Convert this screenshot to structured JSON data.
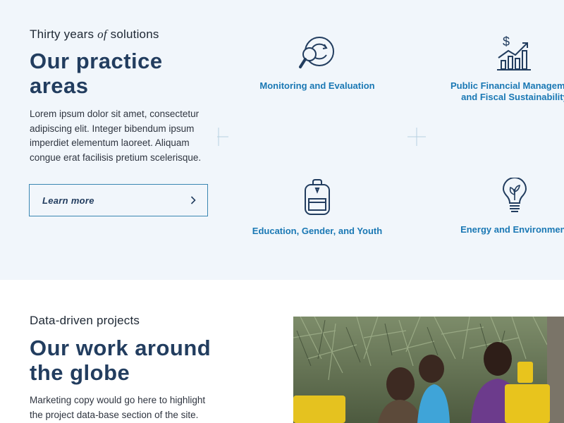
{
  "practice": {
    "eyebrow_pre": "Thirty years ",
    "eyebrow_em": "of",
    "eyebrow_post": " solutions",
    "title_line1": "Our practice",
    "title_line2": "areas",
    "body": "Lorem ipsum dolor sit amet, consectetur adipiscing elit. Integer bibendum ipsum imperdiet elementum laoreet. Aliquam congue erat facilisis pretium scelerisque.",
    "cta_label": "Learn more",
    "areas": [
      {
        "label": "Monitoring and Evaluation",
        "icon": "magnifier-refresh-icon"
      },
      {
        "label": "Public Financial Management",
        "label2": "and Fiscal Sustainability",
        "icon": "dollar-growth-chart-icon"
      },
      {
        "label": "Education, Gender, and Youth",
        "icon": "backpack-icon"
      },
      {
        "label": "Energy and Environment",
        "icon": "leaf-lightbulb-icon"
      }
    ]
  },
  "projects": {
    "eyebrow": "Data-driven projects",
    "title_line1": "Our work around",
    "title_line2": "the globe",
    "body": "Marketing copy would go here to highlight the project data-base section of the site."
  },
  "colors": {
    "accent": "#1a78b4",
    "heading": "#223d5f",
    "section_bg": "#f1f6fb"
  }
}
